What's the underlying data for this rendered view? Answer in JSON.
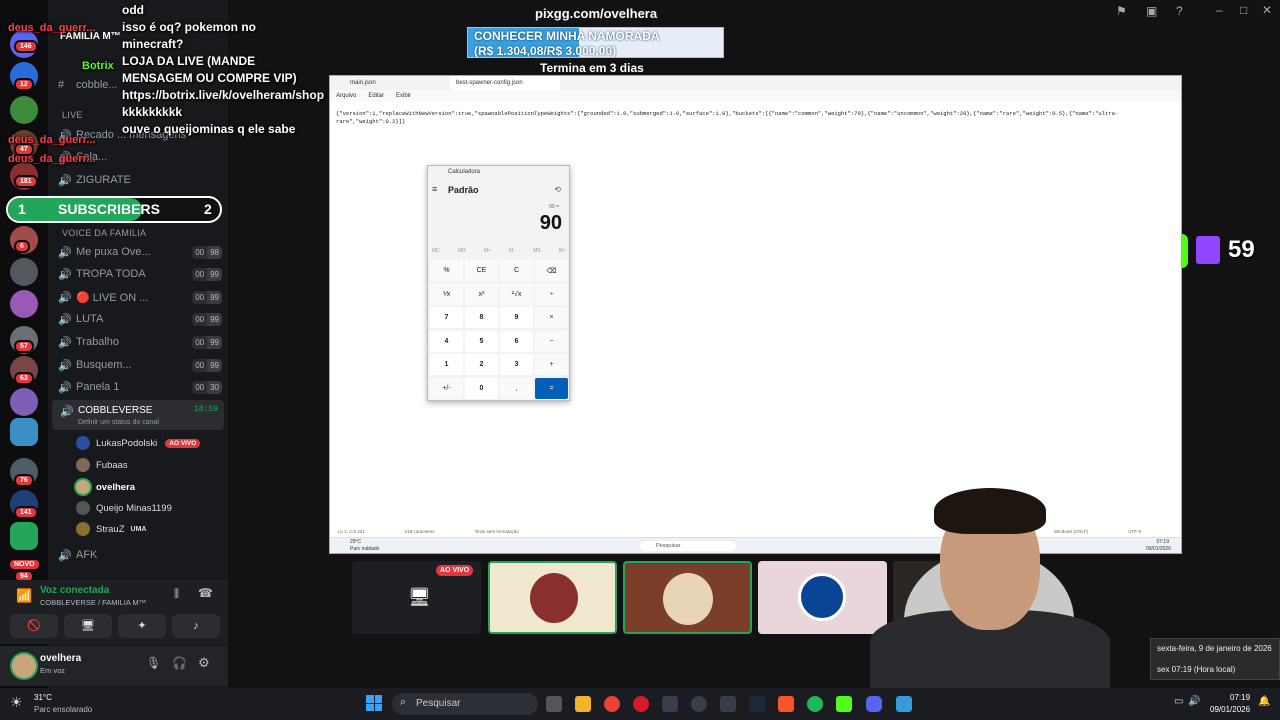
{
  "stream_header": {
    "site": "pixgg.com/ovelhera",
    "goal_title": "CONHECER MINHA NAMORADA",
    "goal_amount": "(R$ 1.304,08/R$ 3.000,00)",
    "countdown": "Termina em 3 dias"
  },
  "chat": [
    {
      "user": "",
      "text": "odd"
    },
    {
      "user": "",
      "text": "isso é oq? pokemon no minecraft?"
    },
    {
      "user": "",
      "text": "LOJA DA LIVE (MANDE MENSAGEM OU COMPRE VIP) https://botrix.live/k/ovelheram/shop"
    },
    {
      "user": "",
      "text": "kkkkkkkkk"
    },
    {
      "user": "",
      "text": "ouve o queijominas q ele sabe"
    }
  ],
  "chat_users": {
    "u1": "deus_da_guerr...",
    "u2": "Botrix",
    "u3": "deus_da_guerr...",
    "u4": "deus_da_guerr..."
  },
  "subscribers": {
    "left": "1",
    "label": "SUBSCRIBERS",
    "right": "2"
  },
  "viewers": {
    "count": "59"
  },
  "server": {
    "name": "FAMILIA M™"
  },
  "rail_badges": [
    "146",
    "12",
    "47",
    "181",
    "6",
    "57",
    "63",
    "76",
    "141",
    "94"
  ],
  "novo_badge": "NOVO",
  "channels_top": [
    {
      "icon": "#",
      "label": "cobble..."
    },
    {
      "icon": "",
      "label": "LIVE"
    },
    {
      "icon": "🔊",
      "label": "Recado ... mensagens"
    },
    {
      "icon": "🔊",
      "label": "Sala..."
    },
    {
      "icon": "🔊",
      "label": "ZIGURATE"
    }
  ],
  "voice_category": "VOICE DA FAMILIA",
  "voice_channels": [
    {
      "label": "Me puxa Ove...",
      "a": "00",
      "b": "98"
    },
    {
      "label": "TROPA TODA",
      "a": "00",
      "b": "99"
    },
    {
      "label": "🔴 LIVE ON ...",
      "a": "00",
      "b": "99"
    },
    {
      "label": "LUTA",
      "a": "00",
      "b": "99"
    },
    {
      "label": "Trabalho",
      "a": "00",
      "b": "99"
    },
    {
      "label": "Busquem...",
      "a": "00",
      "b": "99"
    },
    {
      "label": "Panela 1",
      "a": "00",
      "b": "30"
    }
  ],
  "active_channel": {
    "label": "COBBLEVERSE",
    "time": "18:59",
    "status": "Definir um status do canal"
  },
  "voice_users": [
    {
      "name": "LukasPodolski",
      "badge": "AO VIVO"
    },
    {
      "name": "Fubaas",
      "badge": ""
    },
    {
      "name": "ovelhera",
      "badge": ""
    },
    {
      "name": "Queijo Minas1199",
      "badge": ""
    },
    {
      "name": "StrauZ",
      "badge": "UMA"
    }
  ],
  "afk": "AFK",
  "voice_panel": {
    "status": "Voz conectada",
    "path": "COBBLEVERSE / FAMILIA M™"
  },
  "user_panel": {
    "name": "ovelhera",
    "status": "Em voz"
  },
  "notepad": {
    "tabs": [
      "main.json",
      "best-spawner-config.json"
    ],
    "menu": [
      "Arquivo",
      "Editar",
      "Exibir"
    ],
    "content": "{\"version\":1,\"replaceWithNewVersion\":true,\"spawnablePositionTypeWeights\":{\"grounded\":1.0,\"submerged\":1.0,\"surface\":1.0},\"buckets\":[{\"name\":\"common\",\"weight\":70},{\"name\":\"uncommon\",\"weight\":20},{\"name\":\"rare\",\"weight\":0.5},{\"name\":\"ultra-rare\",\"weight\":0.2}]}",
    "status": [
      "Ln 1, Col 221",
      "218 caracteres",
      "Texto sem formatação",
      "Windows (CRLF)",
      "UTF-8"
    ]
  },
  "inner_taskbar": {
    "weather": "29°C",
    "weather_desc": "Parc nublado",
    "search": "Pesquisar",
    "time": "07:19",
    "date": "09/01/2026"
  },
  "calculator": {
    "title": "Calculadora",
    "mode": "Padrão",
    "expression": "90 =",
    "display": "90",
    "memory": [
      "MC",
      "MR",
      "M+",
      "M-",
      "MS",
      "M~"
    ],
    "keys": [
      "%",
      "CE",
      "C",
      "⌫",
      "⅟x",
      "x²",
      "²√x",
      "÷",
      "7",
      "8",
      "9",
      "×",
      "4",
      "5",
      "6",
      "−",
      "1",
      "2",
      "3",
      "+",
      "+/-",
      "0",
      ",",
      "="
    ]
  },
  "tiles": {
    "live_label": "AO VIVO"
  },
  "clock_tooltip": {
    "date": "sexta-feira, 9 de janeiro de 2026",
    "time": "sex 07:19 (Hora local)"
  },
  "taskbar": {
    "weather": "31°C",
    "weather_desc": "Parc ensolarado",
    "search": "Pesquisar",
    "time": "07:19",
    "date": "09/01/2026"
  },
  "colors": {
    "accent": "#005fb8",
    "discord_green": "#23a55a",
    "live_red": "#e0383e",
    "kick_green": "#53fc18"
  }
}
